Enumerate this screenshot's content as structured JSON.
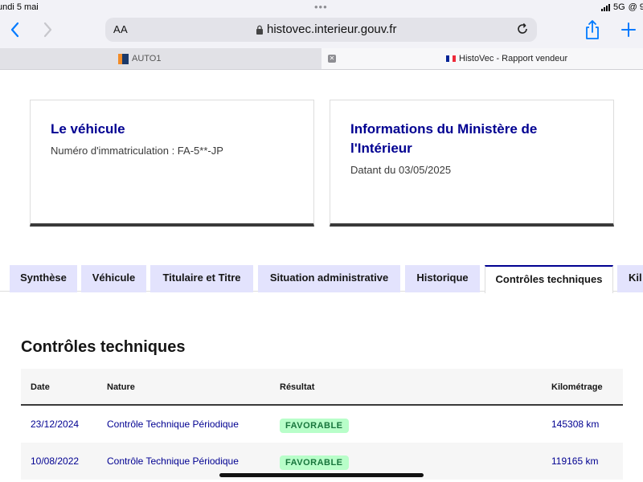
{
  "status_bar": {
    "date": "undi 5 mai",
    "network": "5G",
    "extra": "@ 9"
  },
  "browser": {
    "text_size_label": "AA",
    "url": "histovec.interieur.gouv.fr",
    "tabs": [
      {
        "title": "AUTO1",
        "active": false
      },
      {
        "title": "HistoVec - Rapport vendeur",
        "active": true
      }
    ]
  },
  "cards": {
    "vehicle": {
      "title": "Le véhicule",
      "registration": "Numéro d'immatriculation : FA-5**-JP"
    },
    "ministry": {
      "title_line1": "Informations du Ministère de",
      "title_line2": "l'Intérieur",
      "date": "Datant du 03/05/2025"
    }
  },
  "report_tabs": [
    {
      "label": "Synthèse",
      "active": false
    },
    {
      "label": "Véhicule",
      "active": false
    },
    {
      "label": "Titulaire et Titre",
      "active": false
    },
    {
      "label": "Situation administrative",
      "active": false
    },
    {
      "label": "Historique",
      "active": false
    },
    {
      "label": "Contrôles techniques",
      "active": true
    },
    {
      "label": "Kil",
      "active": false
    }
  ],
  "technical_controls": {
    "title": "Contrôles techniques",
    "columns": [
      "Date",
      "Nature",
      "Résultat",
      "Kilométrage"
    ],
    "rows": [
      {
        "date": "23/12/2024",
        "nature": "Contrôle Technique Périodique",
        "result": "FAVORABLE",
        "km": "145308 km"
      },
      {
        "date": "10/08/2022",
        "nature": "Contrôle Technique Périodique",
        "result": "FAVORABLE",
        "km": "119165 km"
      }
    ]
  },
  "colors": {
    "brand_blue": "#000091",
    "tab_bg": "#e3e3fd",
    "badge_bg": "#b8fec9",
    "badge_text": "#18753c"
  }
}
